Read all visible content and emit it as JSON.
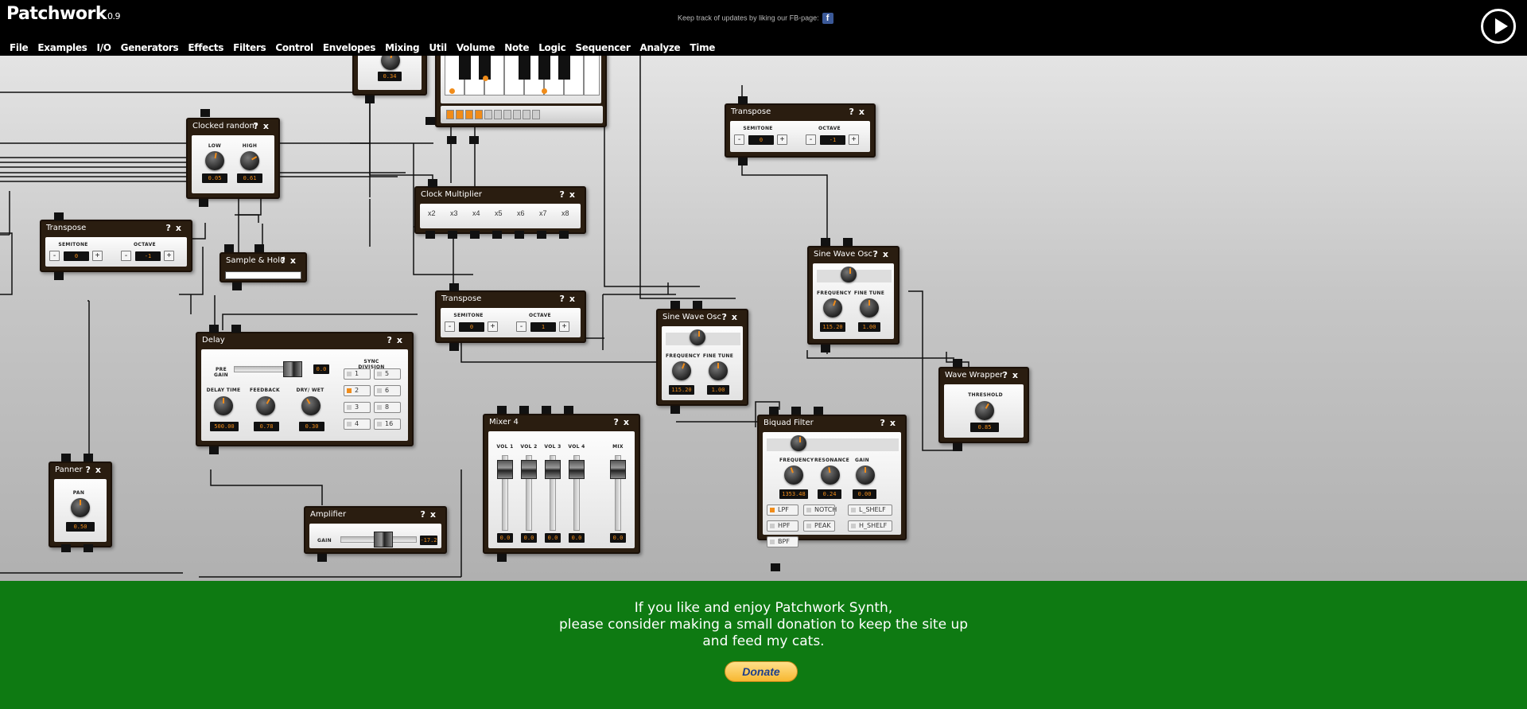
{
  "app": {
    "title": "Patchwork",
    "version": "0.9",
    "fb_note": "Keep track of updates by liking our FB-page:",
    "fb_icon": "facebook-icon",
    "play_icon": "play-icon"
  },
  "menu": [
    "File",
    "Examples",
    "I/O",
    "Generators",
    "Effects",
    "Filters",
    "Control",
    "Envelopes",
    "Mixing",
    "Util",
    "Volume",
    "Note",
    "Logic",
    "Sequencer",
    "Analyze",
    "Time"
  ],
  "module_controls": {
    "help": "?",
    "close": "x"
  },
  "modules": {
    "top_knob": {
      "value": "0.34"
    },
    "clocked_random": {
      "title": "Clocked random",
      "low_label": "LOW",
      "high_label": "HIGH",
      "low": "0.05",
      "high": "0.61"
    },
    "transpose_left": {
      "title": "Transpose",
      "semitone_label": "SEMITONE",
      "octave_label": "OCTAVE",
      "semitone": "0",
      "octave": "-1"
    },
    "transpose_right": {
      "title": "Transpose",
      "semitone_label": "SEMITONE",
      "octave_label": "OCTAVE",
      "semitone": "0",
      "octave": "-1"
    },
    "transpose_mid": {
      "title": "Transpose",
      "semitone_label": "SEMITONE",
      "octave_label": "OCTAVE",
      "semitone": "0",
      "octave": "1"
    },
    "sample_hold": {
      "title": "Sample & Hold"
    },
    "clock_multiplier": {
      "title": "Clock Multiplier",
      "options": [
        "x2",
        "x3",
        "x4",
        "x5",
        "x6",
        "x7",
        "x8"
      ]
    },
    "delay": {
      "title": "Delay",
      "pre_gain_label": "PRE GAIN",
      "pre_gain": "0.0",
      "sync_label": "SYNC DIVISION",
      "sync_options": [
        "1",
        "5",
        "2",
        "6",
        "3",
        "8",
        "4",
        "16"
      ],
      "sync_selected": "2",
      "delay_time_label": "DELAY TIME",
      "feedback_label": "FEEDBACK",
      "drywet_label": "DRY/ WET",
      "delay_time": "500.00",
      "feedback": "0.78",
      "drywet": "0.30"
    },
    "panner": {
      "title": "Panner",
      "pan_label": "PAN",
      "pan": "0.50"
    },
    "amplifier": {
      "title": "Amplifier",
      "gain_label": "GAIN",
      "gain": "-17.2"
    },
    "mixer4": {
      "title": "Mixer 4",
      "labels": [
        "VOL 1",
        "VOL 2",
        "VOL 3",
        "VOL 4",
        "MIX"
      ],
      "values": [
        "0.0",
        "0.0",
        "0.0",
        "0.0",
        "0.0"
      ]
    },
    "sine1": {
      "title": "Sine Wave Osc",
      "freq_label": "FREQUENCY",
      "fine_label": "FINE TUNE",
      "freq": "115.20",
      "fine": "1.00"
    },
    "sine2": {
      "title": "Sine Wave Osc",
      "freq_label": "FREQUENCY",
      "fine_label": "FINE TUNE",
      "freq": "115.20",
      "fine": "1.00"
    },
    "biquad": {
      "title": "Biquad Filter",
      "freq_label": "FREQUENCY",
      "res_label": "RESONANCE",
      "gain_label": "GAIN",
      "freq": "1353.48",
      "res": "0.24",
      "gain": "0.00",
      "types": [
        "LPF",
        "NOTCH",
        "L_SHELF",
        "HPF",
        "PEAK",
        "H_SHELF",
        "BPF"
      ],
      "selected": "LPF"
    },
    "wave_wrapper": {
      "title": "Wave Wrapper",
      "threshold_label": "THRESHOLD",
      "threshold": "0.85"
    }
  },
  "donate": {
    "line1": "If you like and enjoy Patchwork Synth,",
    "line2": "please consider making a small donation to keep the site up",
    "line3": "and feed my cats.",
    "button": "Donate"
  }
}
